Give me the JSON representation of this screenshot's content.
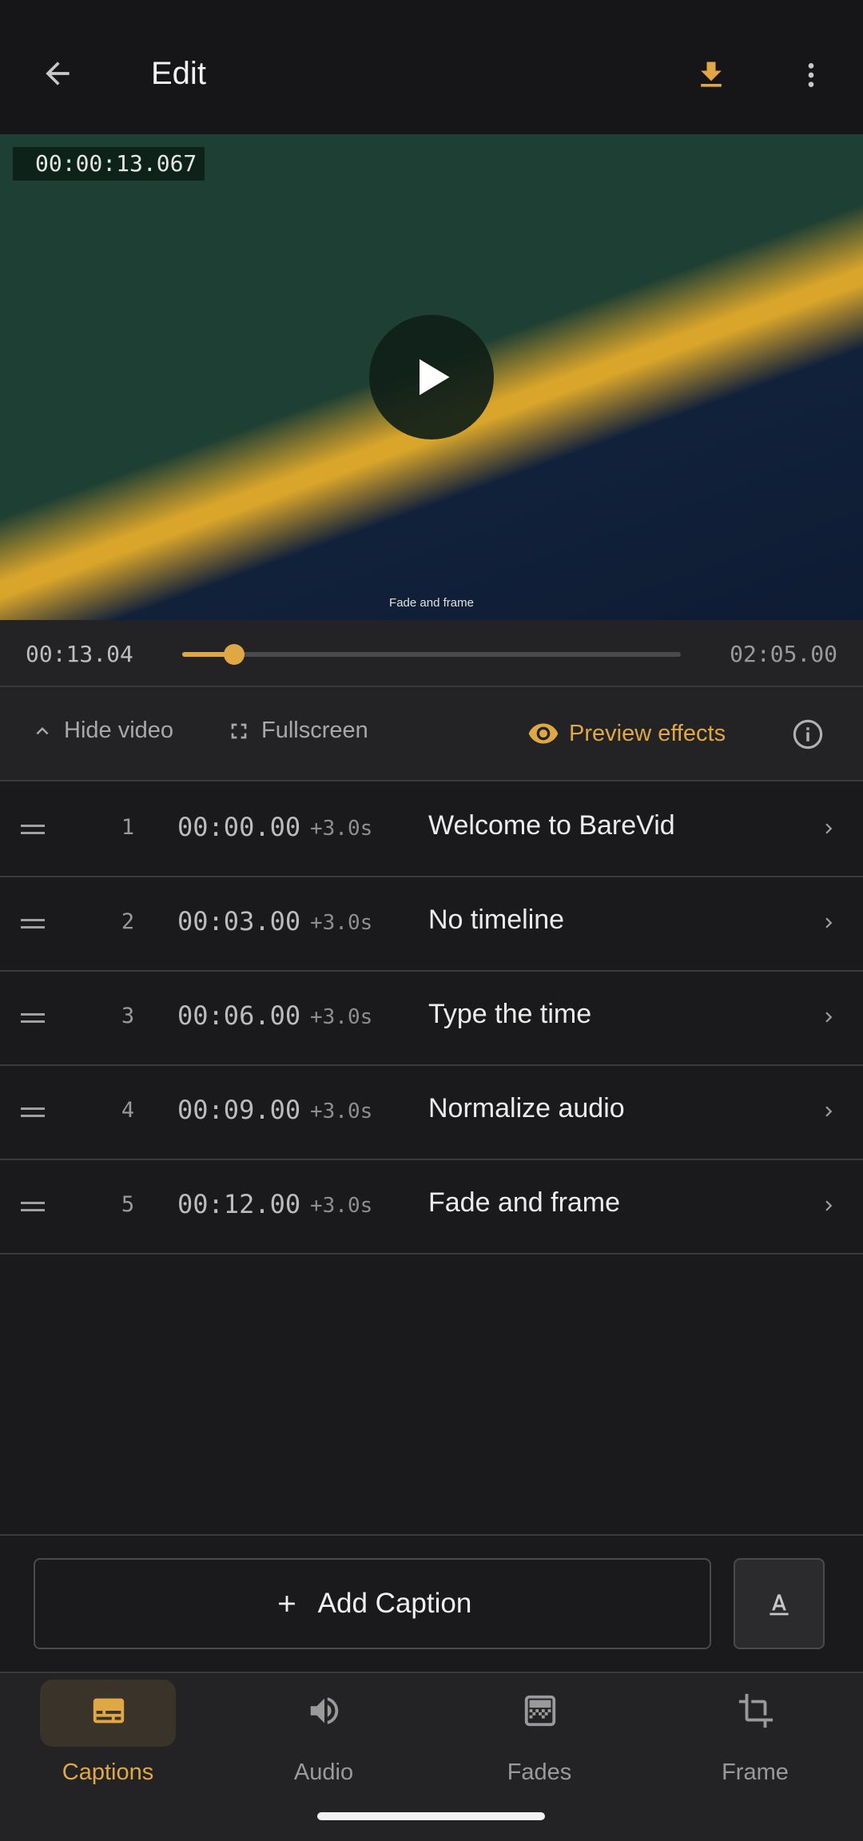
{
  "header": {
    "title": "Edit",
    "back_icon": "arrow-back-icon",
    "download_icon": "download-icon",
    "more_icon": "more-vert-icon"
  },
  "video": {
    "timecode": "00:00:13.067",
    "overlay_caption": "Fade and frame",
    "play_icon": "play-icon"
  },
  "scrubber": {
    "current": "00:13.04",
    "total": "02:05.00",
    "progress": 0.104
  },
  "controls": {
    "hide_video": "Hide video",
    "fullscreen": "Fullscreen",
    "preview_effects": "Preview effects"
  },
  "captions": [
    {
      "num": "1",
      "start": "00:00.00",
      "dur": "+3.0s",
      "text": "Welcome to BareVid"
    },
    {
      "num": "2",
      "start": "00:03.00",
      "dur": "+3.0s",
      "text": "No timeline"
    },
    {
      "num": "3",
      "start": "00:06.00",
      "dur": "+3.0s",
      "text": "Type the time"
    },
    {
      "num": "4",
      "start": "00:09.00",
      "dur": "+3.0s",
      "text": "Normalize audio"
    },
    {
      "num": "5",
      "start": "00:12.00",
      "dur": "+3.0s",
      "text": "Fade and frame"
    }
  ],
  "actions": {
    "add_caption": "Add Caption"
  },
  "nav": {
    "captions": "Captions",
    "audio": "Audio",
    "fades": "Fades",
    "frame": "Frame"
  },
  "colors": {
    "accent": "#e0a845",
    "background": "#1a1a1c",
    "surface": "#232325"
  }
}
